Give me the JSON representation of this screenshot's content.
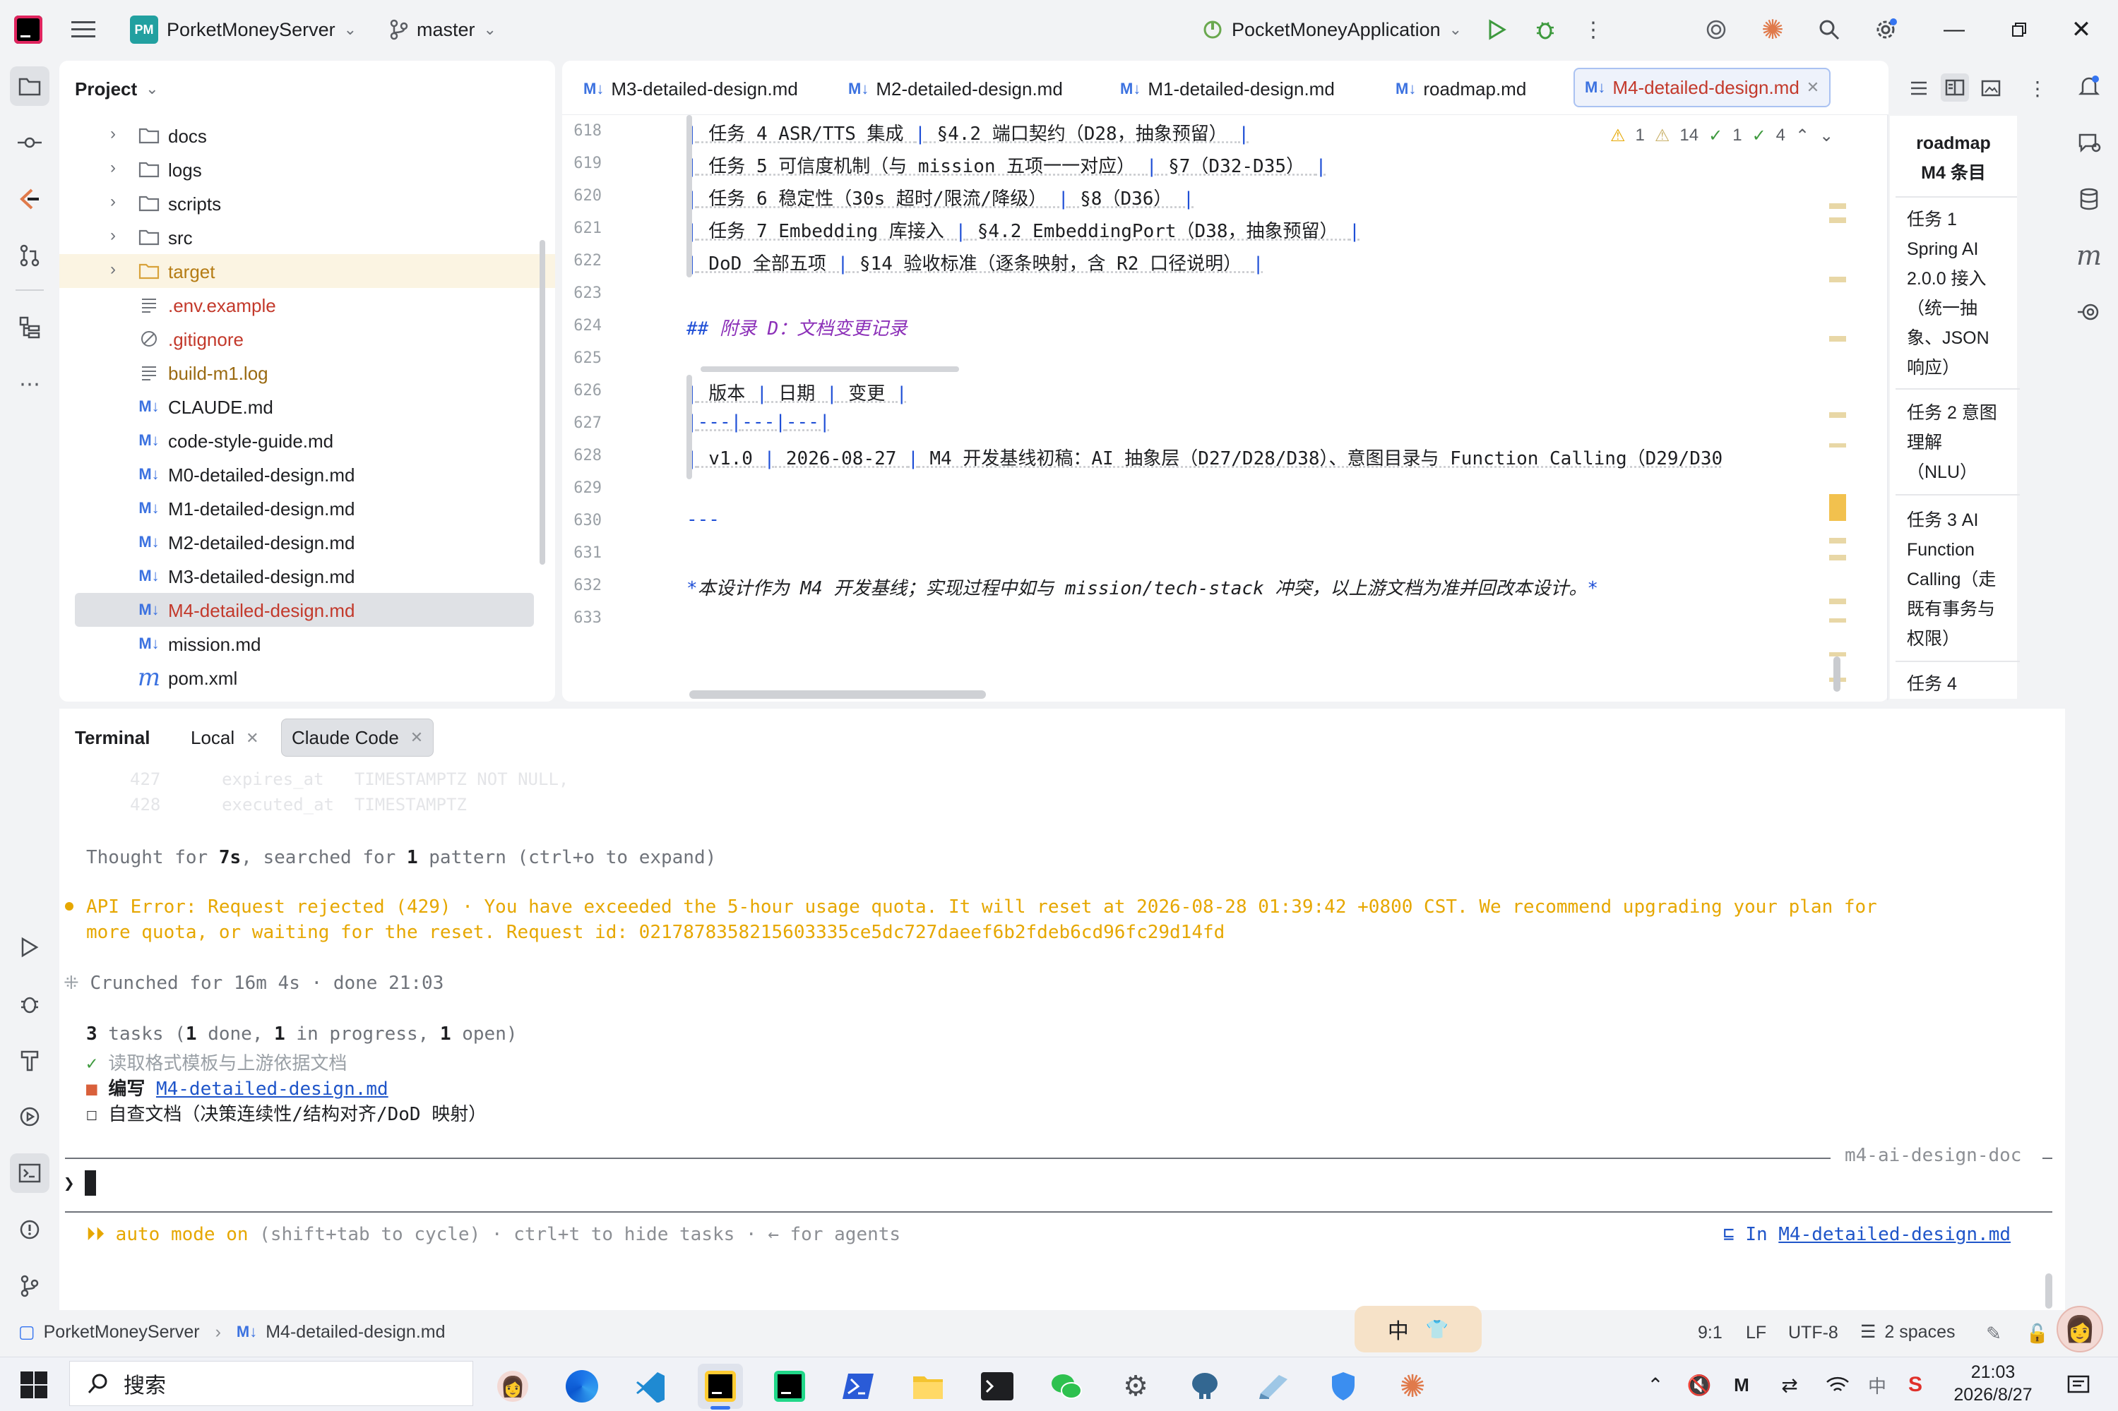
{
  "window": {
    "project_badge": "PM",
    "project_name": "PorketMoneyServer",
    "branch": "master",
    "run_config": "PocketMoneyApplication"
  },
  "left_toolbar": [
    "folder-icon",
    "commit-icon",
    "claude-icon",
    "pull-requests-icon",
    "structure-icon",
    "more-icon",
    "run-icon",
    "debug-icon",
    "build-icon",
    "services-icon",
    "terminal-icon",
    "problems-icon",
    "git-icon"
  ],
  "project_panel": {
    "title": "Project",
    "items": [
      {
        "label": "docs",
        "type": "folder",
        "expandable": true
      },
      {
        "label": "logs",
        "type": "folder",
        "expandable": true
      },
      {
        "label": "scripts",
        "type": "folder",
        "expandable": true
      },
      {
        "label": "src",
        "type": "folder",
        "expandable": true
      },
      {
        "label": "target",
        "type": "folder-excluded",
        "expandable": true
      },
      {
        "label": ".env.example",
        "type": "text"
      },
      {
        "label": ".gitignore",
        "type": "ignore"
      },
      {
        "label": "build-m1.log",
        "type": "text"
      },
      {
        "label": "CLAUDE.md",
        "type": "md"
      },
      {
        "label": "code-style-guide.md",
        "type": "md"
      },
      {
        "label": "M0-detailed-design.md",
        "type": "md"
      },
      {
        "label": "M1-detailed-design.md",
        "type": "md"
      },
      {
        "label": "M2-detailed-design.md",
        "type": "md"
      },
      {
        "label": "M3-detailed-design.md",
        "type": "md"
      },
      {
        "label": "M4-detailed-design.md",
        "type": "md",
        "selected": true
      },
      {
        "label": "mission.md",
        "type": "md"
      },
      {
        "label": "pom.xml",
        "type": "maven"
      }
    ]
  },
  "editor": {
    "tabs": [
      {
        "label": "M3-detailed-design.md"
      },
      {
        "label": "M2-detailed-design.md"
      },
      {
        "label": "M1-detailed-design.md"
      },
      {
        "label": "roadmap.md"
      },
      {
        "label": "M4-detailed-design.md",
        "active": true
      }
    ],
    "md_badge": "M↓",
    "inspections": {
      "warn1": "1",
      "warn2": "14",
      "ok1": "1",
      "ok2": "4"
    },
    "lines": [
      {
        "n": "618",
        "text": "| 任务 4 ASR/TTS 集成 | §4.2 端口契约（D28，抽象预留） |"
      },
      {
        "n": "619",
        "text": "| 任务 5 可信度机制（与 mission 五项一一对应） | §7（D32-D35） |"
      },
      {
        "n": "620",
        "text": "| 任务 6 稳定性（30s 超时/限流/降级） | §8（D36） |"
      },
      {
        "n": "621",
        "text": "| 任务 7 Embedding 库接入 | §4.2 EmbeddingPort（D38，抽象预留） |"
      },
      {
        "n": "622",
        "text": "| DoD 全部五项 | §14 验收标准（逐条映射，含 R2 口径说明） |"
      },
      {
        "n": "623",
        "text": ""
      },
      {
        "n": "624",
        "text": "## 附录 D：文档变更记录"
      },
      {
        "n": "625",
        "text": ""
      },
      {
        "n": "626",
        "text": "| 版本 | 日期 | 变更 |"
      },
      {
        "n": "627",
        "text": "|---|---|---|"
      },
      {
        "n": "628",
        "text": "| v1.0 | 2026-08-27 | M4 开发基线初稿：AI 抽象层（D27/D28/D38）、意图目录与 Function Calling（D29/D30"
      },
      {
        "n": "629",
        "text": ""
      },
      {
        "n": "630",
        "text": "---"
      },
      {
        "n": "631",
        "text": ""
      },
      {
        "n": "632",
        "text": "*本设计作为 M4 开发基线；实现过程中如与 mission/tech-stack 冲突，以上游文档为准并回改本设计。*"
      },
      {
        "n": "633",
        "text": ""
      }
    ]
  },
  "roadmap_panel": {
    "title": "roadmap M4 条目",
    "items": [
      "任务 1 Spring AI 2.0.0 接入（统一抽象、JSON 响应）",
      "任务 2 意图理解（NLU）",
      "任务 3 AI Function Calling（走既有事务与权限）",
      "任务 4"
    ]
  },
  "terminal": {
    "tabs": [
      {
        "label": "Terminal",
        "active": false,
        "bold": true
      },
      {
        "label": "Local",
        "closable": true
      },
      {
        "label": "Claude Code",
        "closable": true,
        "active": true
      }
    ],
    "faded_lines": [
      {
        "n": "427",
        "text": "expires_at   TIMESTAMPTZ NOT NULL,"
      },
      {
        "n": "428",
        "text": "executed_at  TIMESTAMPTZ"
      }
    ],
    "thought": {
      "prefix": "Thought for ",
      "time": "7s",
      "mid": ", searched for ",
      "count": "1",
      "suffix": " pattern (ctrl+o to expand)"
    },
    "error_line1": "API Error: Request rejected (429) · You have exceeded the 5-hour usage quota. It will reset at 2026-08-28 01:39:42 +0800 CST. We recommend upgrading your plan for",
    "error_line2": "more quota, or waiting for the reset. Request id: 0217878358215603335ce5dc727daeef6b2fdeb6cd96fc29d14fd",
    "crunched": "Crunched for 16m 4s · done 21:03",
    "tasks_summary": {
      "a": "3",
      "b": " tasks (",
      "c": "1",
      "d": " done, ",
      "e": "1",
      "f": " in progress, ",
      "g": "1",
      "h": " open)"
    },
    "tasks": [
      {
        "status": "done",
        "text": "读取格式模板与上游依据文档"
      },
      {
        "status": "in_progress",
        "prefix": "编写 ",
        "link": "M4-detailed-design.md"
      },
      {
        "status": "open",
        "text": "自查文档（决策连续性/结构对齐/DoD 映射）"
      }
    ],
    "session_name": "m4-ai-design-doc",
    "prompt_symbol": "❯",
    "mode_arrows": "⏵⏵",
    "mode_on": "auto mode on",
    "mode_hint": " (shift+tab to cycle) · ctrl+t to hide tasks · ← for agents",
    "in_file_prefix": "In ",
    "in_file_link": "M4-detailed-design.md"
  },
  "status_bar": {
    "breadcrumb_project": "PorketMoneyServer",
    "breadcrumb_file": "M4-detailed-design.md",
    "ime_char": "中",
    "position": "9:1",
    "line_sep": "LF",
    "encoding": "UTF-8",
    "indent": "2 spaces"
  },
  "taskbar": {
    "search_placeholder": "搜索",
    "time": "21:03",
    "date": "2026/8/27",
    "apps": [
      "avatar-app-icon",
      "browser-icon",
      "vscode-icon",
      "intellij-icon",
      "datagrip-icon",
      "powershell-icon",
      "file-explorer-icon",
      "terminal-app-icon",
      "wechat-icon",
      "settings-icon",
      "postgres-icon",
      "notes-icon",
      "shield-app-icon",
      "claude-app-icon"
    ]
  },
  "colors": {
    "accent": "#3574f0",
    "error_orange": "#e6a700",
    "link_blue": "#1f55c9",
    "selected_row": "#dfe1e5",
    "heading_purple": "#8b2fb8",
    "muted_gray": "#8c8f94"
  }
}
